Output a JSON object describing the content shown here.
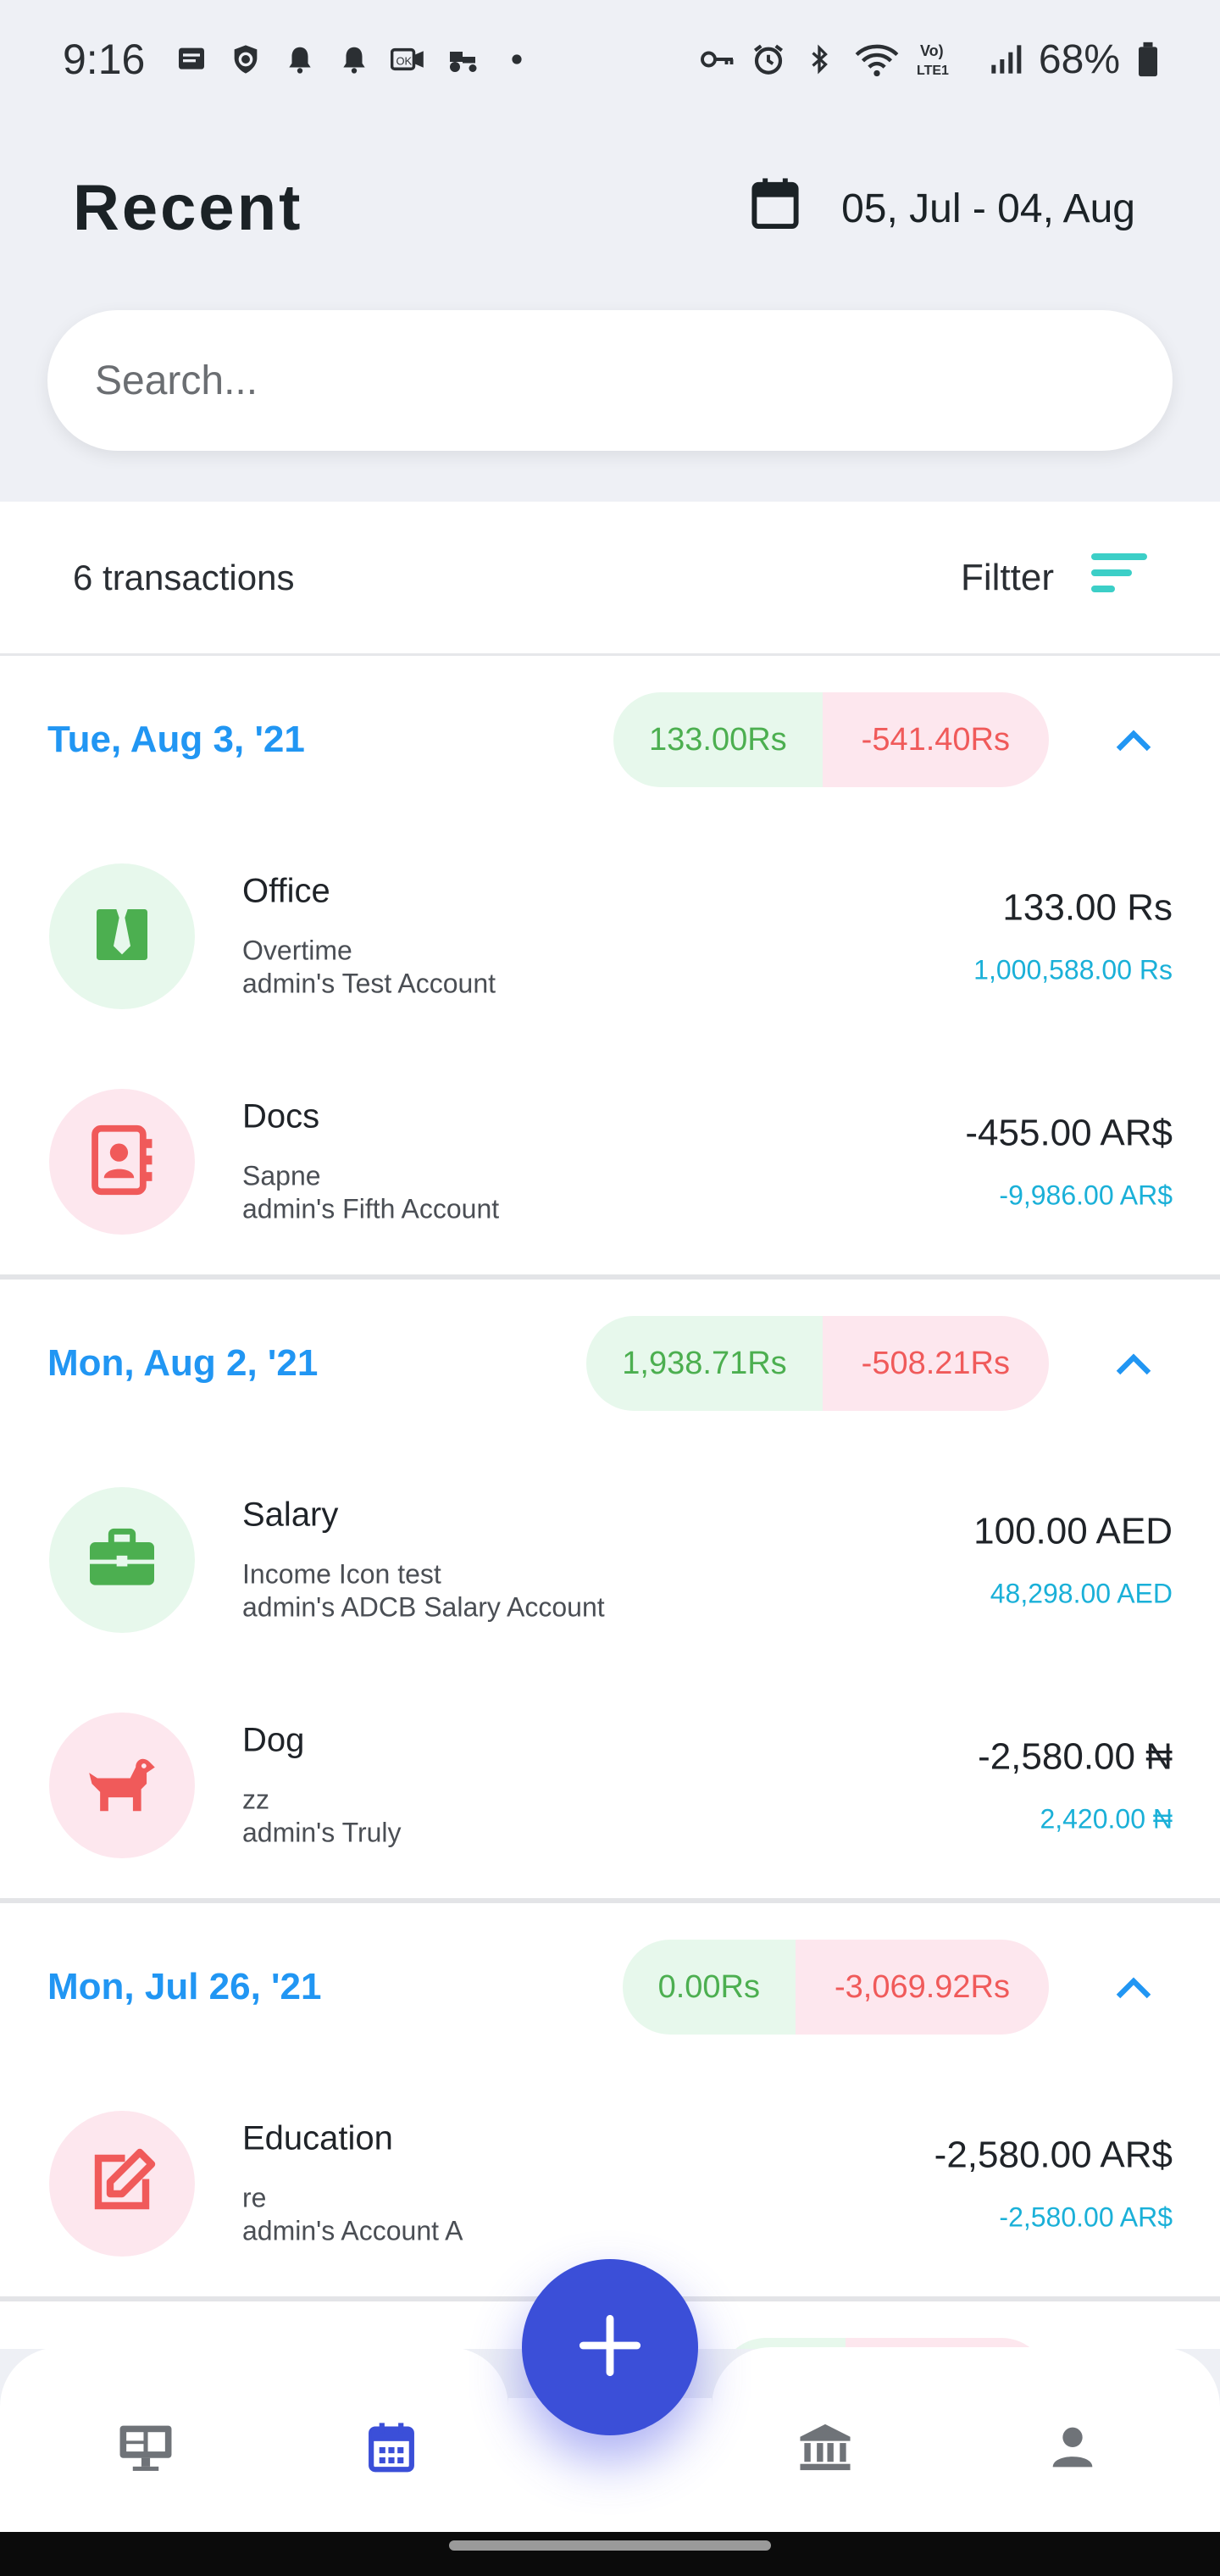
{
  "status_bar": {
    "time": "9:16",
    "battery": "68%",
    "left_icons": [
      "message-icon",
      "shield-icon",
      "bell-icon",
      "bell-icon",
      "vpn-icon",
      "tractor-icon",
      "dot-icon"
    ],
    "right_icons": [
      "key-icon",
      "alarm-icon",
      "bluetooth-icon",
      "wifi-icon",
      "volte-icon",
      "signal-icon",
      "battery-icon"
    ],
    "volte_label": "Vo) LTE1"
  },
  "header": {
    "title": "Recent",
    "date_range": "05, Jul - 04, Aug"
  },
  "search": {
    "placeholder": "Search..."
  },
  "summary": {
    "count_text": "6 transactions",
    "filter_label": "Filtter"
  },
  "colors": {
    "accent_blue": "#2196f3",
    "income_green": "#4caf50",
    "expense_red": "#f05a5a",
    "balance_cyan": "#1ab0d8",
    "fab_blue": "#3b4fd8"
  },
  "groups": [
    {
      "date": "Tue, Aug 3, '21",
      "income": "133.00Rs",
      "expense": "-541.40Rs",
      "transactions": [
        {
          "category": "Office",
          "note": "Overtime",
          "account": "admin's Test Account",
          "amount": "133.00 Rs",
          "balance": "1,000,588.00 Rs",
          "icon": "tie-icon",
          "tone": "green"
        },
        {
          "category": "Docs",
          "note": "Sapne",
          "account": "admin's Fifth Account",
          "amount": "-455.00 AR$",
          "balance": "-9,986.00 AR$",
          "icon": "contact-book-icon",
          "tone": "pink"
        }
      ]
    },
    {
      "date": "Mon, Aug 2, '21",
      "income": "1,938.71Rs",
      "expense": "-508.21Rs",
      "transactions": [
        {
          "category": "Salary",
          "note": "Income Icon test",
          "account": "admin's ADCB Salary Account",
          "amount": "100.00 AED",
          "balance": "48,298.00 AED",
          "icon": "briefcase-icon",
          "tone": "green"
        },
        {
          "category": "Dog",
          "note": "zz",
          "account": "admin's Truly",
          "amount": "-2,580.00 ₦",
          "balance": "2,420.00 ₦",
          "icon": "dog-icon",
          "tone": "pink"
        }
      ]
    },
    {
      "date": "Mon, Jul 26, '21",
      "income": "0.00Rs",
      "expense": "-3,069.92Rs",
      "transactions": [
        {
          "category": "Education",
          "note": "re",
          "account": "admin's Account A",
          "amount": "-2,580.00 AR$",
          "balance": "-2,580.00 AR$",
          "icon": "edit-icon",
          "tone": "pink"
        }
      ]
    }
  ],
  "bottom_nav": {
    "items": [
      "dashboard-icon",
      "calendar-icon",
      "bank-icon",
      "profile-icon"
    ],
    "active": "calendar-icon"
  }
}
